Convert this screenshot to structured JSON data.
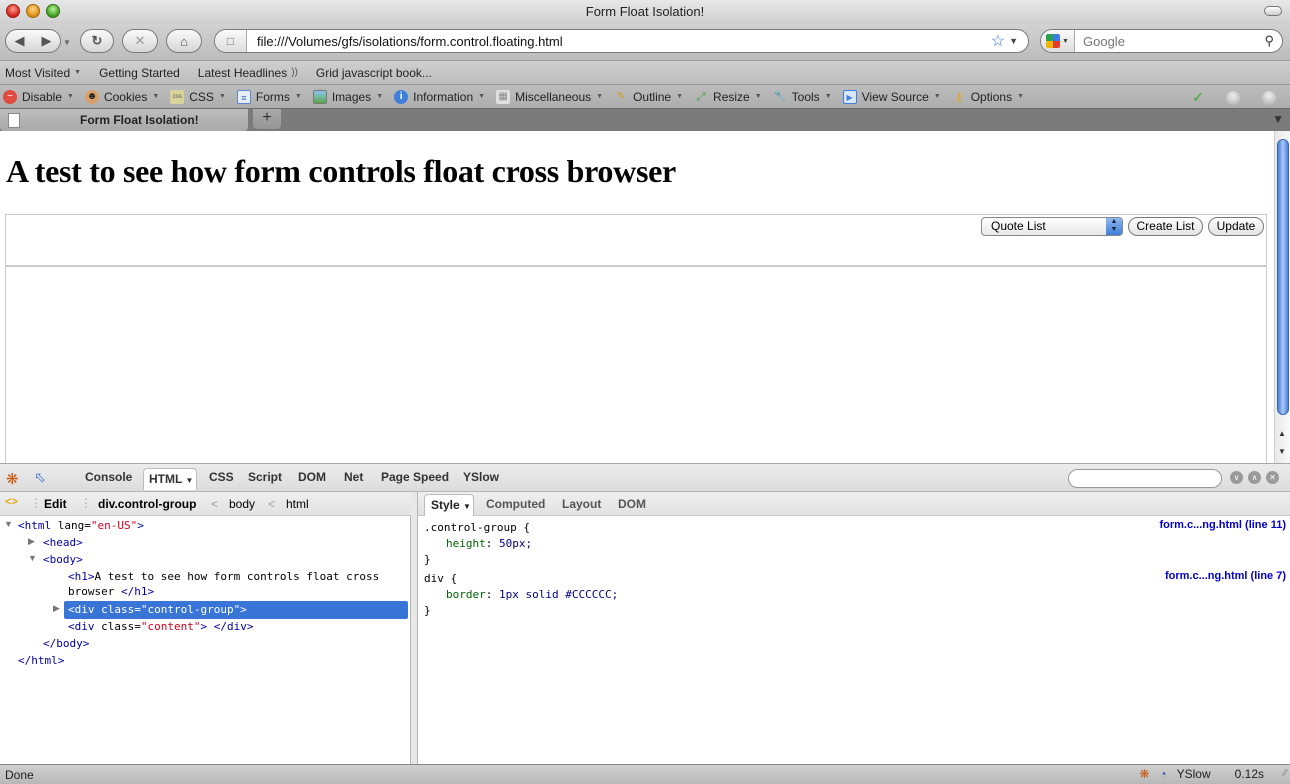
{
  "window": {
    "title": "Form Float Isolation!"
  },
  "navbar": {
    "url": "file:///Volumes/gfs/isolations/form.control.floating.html",
    "search_placeholder": "Google"
  },
  "bookmarks": [
    {
      "label": "Most Visited",
      "dropdown": true
    },
    {
      "label": "Getting Started",
      "dropdown": false
    },
    {
      "label": "Latest Headlines",
      "dropdown": false,
      "rss": true
    },
    {
      "label": "Grid javascript book...",
      "dropdown": false
    }
  ],
  "devtoolbar": {
    "items": [
      {
        "label": "Disable",
        "icon": "disable-icon"
      },
      {
        "label": "Cookies",
        "icon": "cookies-icon"
      },
      {
        "label": "CSS",
        "icon": "css-icon"
      },
      {
        "label": "Forms",
        "icon": "forms-icon"
      },
      {
        "label": "Images",
        "icon": "images-icon"
      },
      {
        "label": "Information",
        "icon": "information-icon"
      },
      {
        "label": "Miscellaneous",
        "icon": "miscellaneous-icon"
      },
      {
        "label": "Outline",
        "icon": "outline-icon"
      },
      {
        "label": "Resize",
        "icon": "resize-icon"
      },
      {
        "label": "Tools",
        "icon": "tools-icon"
      },
      {
        "label": "View Source",
        "icon": "view-source-icon"
      },
      {
        "label": "Options",
        "icon": "options-icon"
      }
    ]
  },
  "tabs": [
    {
      "label": "Form Float Isolation!",
      "active": true
    }
  ],
  "page": {
    "heading": "A test to see how form controls float cross browser",
    "select_value": "Quote List",
    "create_button": "Create List",
    "update_button": "Update"
  },
  "firebug": {
    "tabs": [
      "Console",
      "HTML",
      "CSS",
      "Script",
      "DOM",
      "Net",
      "Page Speed",
      "YSlow"
    ],
    "active_tab": "HTML",
    "edit_label": "Edit",
    "breadcrumb": [
      "div.control-group",
      "body",
      "html"
    ],
    "tree": {
      "html_open": "<html",
      "html_attr": " lang=",
      "html_val": "\"en-US\"",
      "html_close": ">",
      "head": "<head>",
      "body": "<body>",
      "h1_open": "<h1>",
      "h1_text_1": "A test to see how form controls float cross",
      "h1_text_2": "browser",
      "h1_close": "</h1>",
      "div_cg": "<div class=\"control-group\">",
      "div_content_open": "<div",
      "div_content_attr": " class=",
      "div_content_val": "\"content\"",
      "div_content_close": "> </div>",
      "body_close": "</body>",
      "html_end": "</html>"
    },
    "side_tabs": [
      "Style",
      "Computed",
      "Layout",
      "DOM"
    ],
    "active_side_tab": "Style",
    "rules": [
      {
        "selector": ".control-group {",
        "prop": "height",
        "value": "50px;",
        "source": "form.c...ng.html (line 11)"
      },
      {
        "selector": "div {",
        "prop": "border",
        "value": "1px solid #CCCCCC;",
        "source": "form.c...ng.html (line 7)"
      }
    ]
  },
  "status": {
    "text": "Done",
    "yslow": "YSlow",
    "time": "0.12s"
  }
}
